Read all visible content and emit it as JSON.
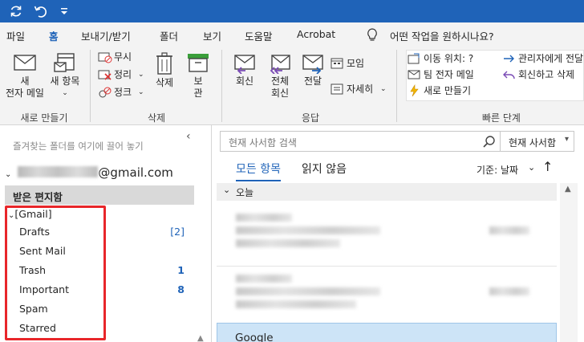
{
  "title_bar": {
    "icons": [
      "sync-icon",
      "undo-icon",
      "customize-quick-access-icon"
    ],
    "background": "#1f63b8"
  },
  "ribbon_tabs": [
    "파일",
    "홈",
    "보내기/받기",
    "폴더",
    "보기",
    "도움말",
    "Acrobat"
  ],
  "tell_me": "어떤 작업을 원하시나요?",
  "ribbon": {
    "new_group": {
      "new_email": "새\n전자 메일",
      "new_items": "새 항목",
      "label": "새로 만들기"
    },
    "delete_group": {
      "ignore": "무시",
      "cleanup": "정리",
      "junk": "정크",
      "delete": "삭제",
      "archive": "보\n관",
      "label": "삭제"
    },
    "respond_group": {
      "reply": "회신",
      "reply_all": "전체\n회신",
      "forward": "전달",
      "meeting": "모임",
      "more": "자세히",
      "label": "응답"
    },
    "quick_steps": {
      "items": [
        "이동 위치: ?",
        "팀 전자 메일",
        "새로 만들기",
        "관리자에게 전달",
        "회신하고 삭제"
      ],
      "label": "빠른 단계"
    }
  },
  "folder_pane": {
    "favorites_hint": "즐겨찾는 폴더를 여기에 끌어 놓기",
    "account": "@gmail.com",
    "inbox": "받은 편지함",
    "gmail_group": "[Gmail]",
    "folders": [
      {
        "name": "Drafts",
        "count": "[2]"
      },
      {
        "name": "Sent Mail",
        "count": ""
      },
      {
        "name": "Trash",
        "count": "1"
      },
      {
        "name": "Important",
        "count": "8"
      },
      {
        "name": "Spam",
        "count": ""
      },
      {
        "name": "Starred",
        "count": ""
      }
    ],
    "highlight_color": "#e8262a"
  },
  "message_list": {
    "search_placeholder": "현재 사서함 검색",
    "search_scope": "현재 사서함",
    "tabs": [
      "모든 항목",
      "읽지 않음"
    ],
    "sort_by": "기준: 날짜",
    "group_header": "오늘",
    "selected_sender": "Google"
  },
  "accent_color": "#1f63b8"
}
